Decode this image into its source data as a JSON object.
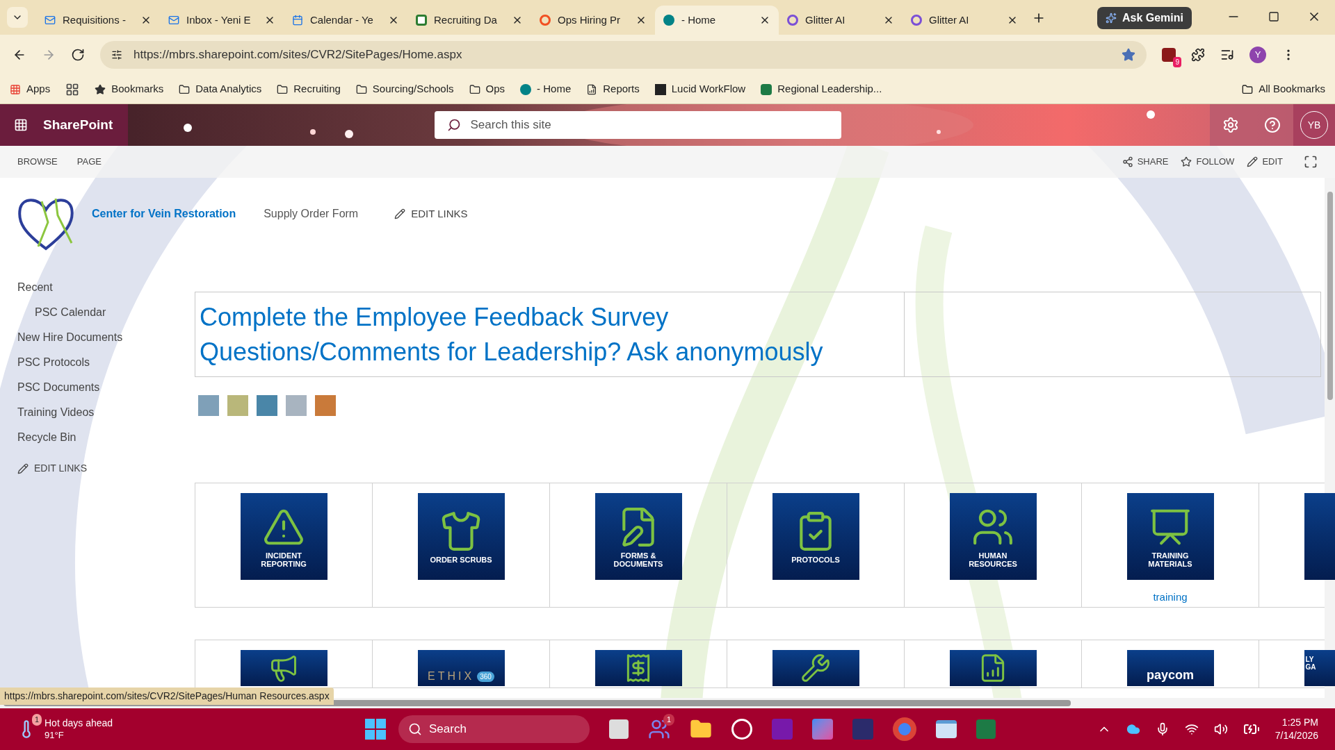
{
  "browser": {
    "tabs": [
      {
        "title": "Requisitions -",
        "kind": "mail",
        "selected": false
      },
      {
        "title": "Inbox - Yeni E",
        "kind": "mail",
        "selected": false
      },
      {
        "title": "Calendar - Ye",
        "kind": "calendar",
        "selected": false
      },
      {
        "title": "Recruiting Da",
        "kind": "board",
        "selected": false
      },
      {
        "title": "Ops Hiring Pr",
        "kind": "ring",
        "selected": false
      },
      {
        "title": "- Home",
        "kind": "site",
        "selected": true
      },
      {
        "title": "Glitter AI",
        "kind": "letter",
        "selected": false
      },
      {
        "title": "Glitter AI",
        "kind": "letter",
        "selected": false
      }
    ],
    "gemini_button": "Ask Gemini",
    "url": "https://mbrs.sharepoint.com/sites/CVR2/SitePages/Home.aspx",
    "extension_badge": "9",
    "profile": "Y",
    "bookmarks": [
      {
        "label": "Apps",
        "kind": "apps"
      },
      {
        "label": "Bookmarks",
        "kind": "star"
      },
      {
        "label": "Data Analytics",
        "kind": "folder"
      },
      {
        "label": "Recruiting",
        "kind": "folder"
      },
      {
        "label": "Sourcing/Schools",
        "kind": "folder"
      },
      {
        "label": "Ops",
        "kind": "folder"
      },
      {
        "label": "- Home",
        "kind": "site"
      },
      {
        "label": "Reports",
        "kind": "chart"
      },
      {
        "label": "Lucid WorkFlow",
        "kind": "lucid"
      },
      {
        "label": "Regional Leadership...",
        "kind": "sheet"
      }
    ],
    "all_bookmarks": "All Bookmarks",
    "status_url": "https://mbrs.sharepoint.com/sites/CVR2/SitePages/Human Resources.aspx"
  },
  "suite_bar": {
    "app_name": "SharePoint",
    "search_placeholder": "Search this site",
    "avatar": "YB"
  },
  "ribbon": {
    "tabs": [
      "BROWSE",
      "PAGE"
    ],
    "actions": [
      {
        "label": "SHARE",
        "kind": "share"
      },
      {
        "label": "FOLLOW",
        "kind": "follow"
      },
      {
        "label": "EDIT",
        "kind": "edit"
      }
    ]
  },
  "site_header": {
    "links": [
      "Center for Vein Restoration",
      "Supply Order Form"
    ],
    "edit_links": "EDIT LINKS"
  },
  "left_nav": {
    "items": [
      {
        "label": "Recent",
        "children": [
          {
            "label": "PSC Calendar"
          }
        ]
      },
      {
        "label": "New Hire Documents"
      },
      {
        "label": "PSC Protocols"
      },
      {
        "label": "PSC Documents"
      },
      {
        "label": "Training Videos"
      },
      {
        "label": "Recycle Bin"
      }
    ],
    "edit_links": "EDIT LINKS"
  },
  "announcements": [
    "Complete the Employee Feedback Survey",
    "Questions/Comments for Leadership? Ask anonymously"
  ],
  "social": [
    {
      "kind": "facebook"
    },
    {
      "kind": "twitter"
    },
    {
      "kind": "linkedin"
    },
    {
      "kind": "youtube"
    },
    {
      "kind": "instagram"
    }
  ],
  "tile_rows": [
    [
      {
        "kind": "icon",
        "label": "INCIDENT REPORTING"
      },
      {
        "kind": "icon",
        "label": "ORDER SCRUBS"
      },
      {
        "kind": "icon",
        "label": "FORMS & DOCUMENTS"
      },
      {
        "kind": "icon",
        "label": "PROTOCOLS"
      },
      {
        "kind": "icon",
        "label": "HUMAN RESOURCES"
      },
      {
        "kind": "icon",
        "label": "TRAINING MATERIALS",
        "caption": "training"
      },
      {
        "kind": "blank"
      }
    ],
    [
      {
        "kind": "icon"
      },
      {
        "kind": "logo",
        "label": "ETHIX",
        "mark": "360"
      },
      {
        "kind": "icon"
      },
      {
        "kind": "icon"
      },
      {
        "kind": "icon"
      },
      {
        "kind": "logo",
        "label": "paycom"
      },
      {
        "kind": "logo",
        "label": "LY GA"
      }
    ]
  ],
  "taskbar": {
    "weather": {
      "title": "Hot days ahead",
      "temp": "91°F",
      "badge": "1"
    },
    "search_placeholder": "Search",
    "teams_badge": "1",
    "time": "1:25 PM",
    "date": "7/14/2026"
  }
}
